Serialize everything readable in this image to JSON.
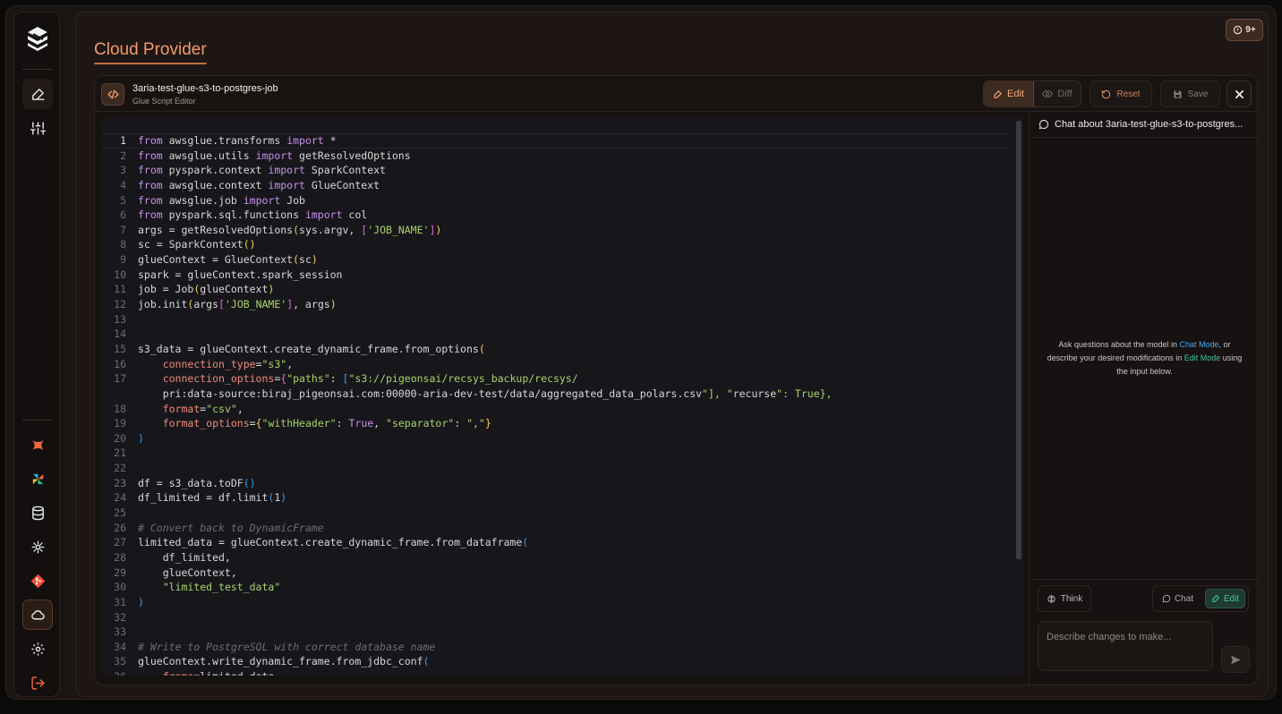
{
  "page": {
    "title": "Cloud Provider",
    "notification_count": "9+"
  },
  "sidebar": {
    "items": [
      {
        "name": "edit",
        "icon": "edit-icon"
      },
      {
        "name": "sliders",
        "icon": "sliders-icon"
      },
      {
        "name": "tool-x",
        "icon": "x-logo-icon"
      },
      {
        "name": "airflow",
        "icon": "pinwheel-icon"
      },
      {
        "name": "database",
        "icon": "database-icon"
      },
      {
        "name": "network",
        "icon": "network-icon"
      },
      {
        "name": "git",
        "icon": "git-icon"
      },
      {
        "name": "cloud",
        "icon": "cloud-icon",
        "active": true
      },
      {
        "name": "settings",
        "icon": "gear-icon"
      },
      {
        "name": "logout",
        "icon": "logout-icon"
      }
    ]
  },
  "editor": {
    "job_name": "3aria-test-glue-s3-to-postgres-job",
    "subtitle": "Glue Script Editor",
    "edit_label": "Edit",
    "diff_label": "Diff",
    "reset_label": "Reset",
    "save_label": "Save",
    "code_lines": [
      "from awsglue.transforms import *",
      "from awsglue.utils import getResolvedOptions",
      "from pyspark.context import SparkContext",
      "from awsglue.context import GlueContext",
      "from awsglue.job import Job",
      "from pyspark.sql.functions import col",
      "args = getResolvedOptions(sys.argv, ['JOB_NAME'])",
      "sc = SparkContext()",
      "glueContext = GlueContext(sc)",
      "spark = glueContext.spark_session",
      "job = Job(glueContext)",
      "job.init(args['JOB_NAME'], args)",
      "",
      "",
      "s3_data = glueContext.create_dynamic_frame.from_options(",
      "    connection_type=\"s3\",",
      "    connection_options={\"paths\": [\"s3://pigeonsai/recsys_backup/recsys/pri:data-source:biraj_pigeonsai.com:00000-aria-dev-test/data/aggregated_data_polars.csv\"], \"recurse\": True},",
      "    format=\"csv\",",
      "    format_options={\"withHeader\": True, \"separator\": \",\"}",
      ")",
      "",
      "",
      "df = s3_data.toDF()",
      "df_limited = df.limit(1)",
      "",
      "# Convert back to DynamicFrame",
      "limited_data = glueContext.create_dynamic_frame.from_dataframe(",
      "    df_limited,",
      "    glueContext,",
      "    \"limited_test_data\"",
      ")",
      "",
      "",
      "# Write to PostgreSQL with correct database name",
      "glueContext.write_dynamic_frame.from_jdbc_conf(",
      "    frame=limited_data,"
    ]
  },
  "chat": {
    "title": "Chat about 3aria-test-glue-s3-to-postgres...",
    "empty_prefix": "Ask questions about the model in ",
    "chat_mode_link": "Chat Mode",
    "empty_middle": ", or describe your desired modifications in ",
    "edit_mode_link": "Edit Mode",
    "empty_suffix": " using the input below.",
    "think_label": "Think",
    "chat_label": "Chat",
    "edit_label": "Edit",
    "input_placeholder": "Describe changes to make...",
    "input_value": ""
  },
  "colors": {
    "accent": "#f59a6b",
    "edit_mode": "#43c9a2",
    "chat_mode": "#48a8ee",
    "background": "#1d1614"
  }
}
